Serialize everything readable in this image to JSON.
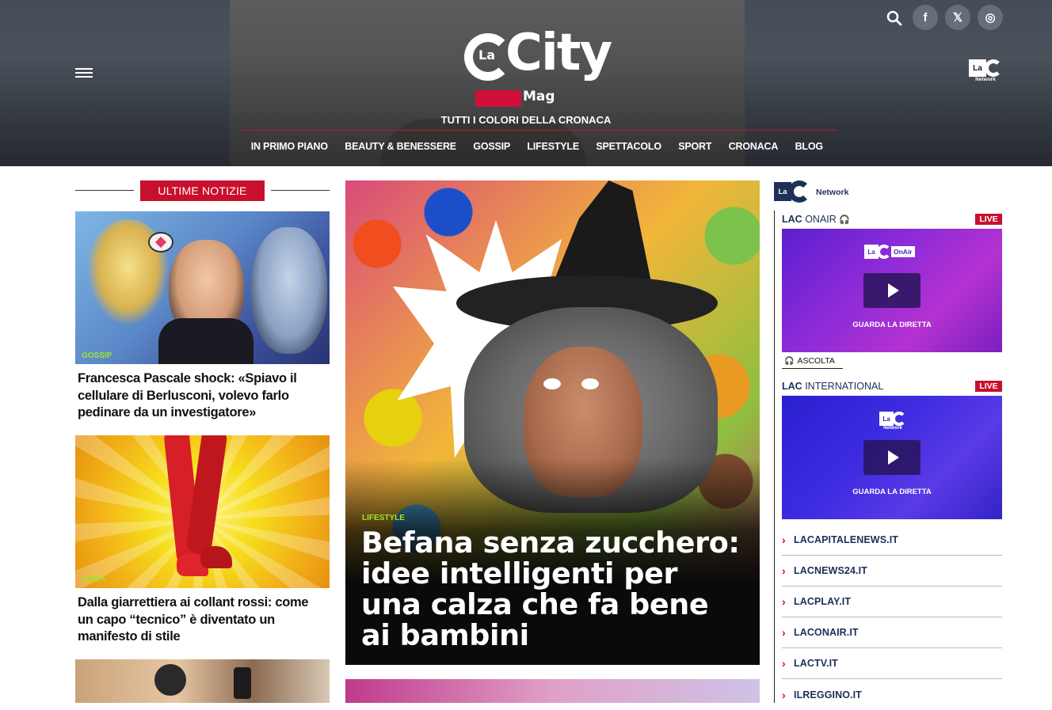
{
  "header": {
    "logo": {
      "la": "La",
      "city": "City",
      "mag": "Mag"
    },
    "tagline": "TUTTI I COLORI DELLA CRONACA",
    "nav": [
      "IN PRIMO PIANO",
      "BEAUTY & BENESSERE",
      "GOSSIP",
      "LIFESTYLE",
      "SPETTACOLO",
      "SPORT",
      "CRONACA",
      "BLOG"
    ],
    "network_logo": {
      "la": "La",
      "sub": "Network"
    },
    "social": {
      "facebook": "f",
      "x": "𝕏",
      "instagram": "◎"
    }
  },
  "left": {
    "section_label": "ULTIME NOTIZIE",
    "cards": [
      {
        "category": "GOSSIP",
        "title": "Francesca Pascale shock: «Spiavo il cellulare di Berlusconi, volevo farlo pedinare da un investigatore»"
      },
      {
        "category": "MODA",
        "title": "Dalla giarrettiera ai collant rossi: come un capo “tecnico” è diventato un manifesto di stile"
      }
    ]
  },
  "hero": {
    "category": "LIFESTYLE",
    "title": "Befana senza zucchero: idee intelligenti per una calza che fa bene ai bambini"
  },
  "right": {
    "network_logo": {
      "la": "La",
      "text": "Network"
    },
    "onair": {
      "brand": "LAC",
      "name": "ONAIR",
      "live": "LIVE",
      "logo_text": "OnAir",
      "caption": "GUARDA LA DIRETTA",
      "listen": "ASCOLTA"
    },
    "international": {
      "brand": "LAC",
      "name": "INTERNATIONAL",
      "live": "LIVE",
      "logo_text": "Network",
      "caption": "GUARDA LA DIRETTA"
    },
    "links": [
      "LACAPITALENEWS.IT",
      "LACNEWS24.IT",
      "LACPLAY.IT",
      "LACONAIR.IT",
      "LACTV.IT",
      "ILREGGINO.IT"
    ]
  },
  "colors": {
    "accent": "#c8102e",
    "category": "#9de62b",
    "navy": "#1e2f5a"
  }
}
